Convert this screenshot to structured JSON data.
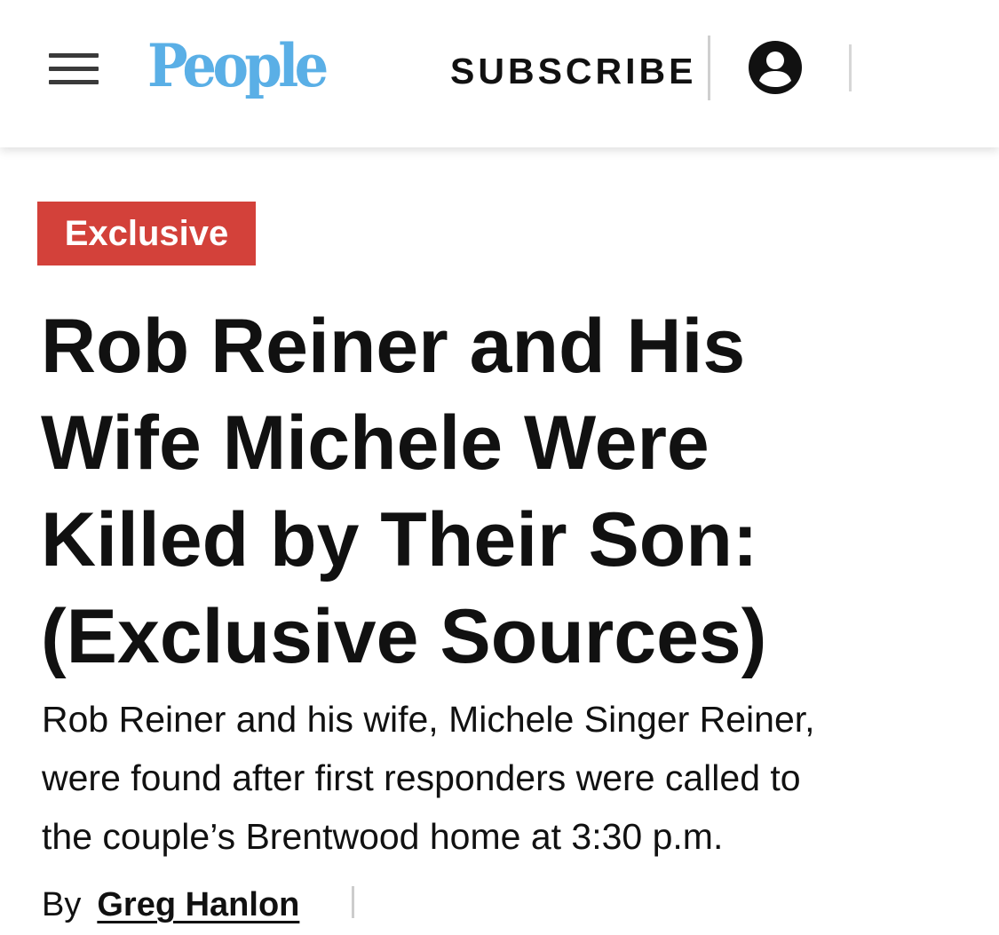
{
  "header": {
    "menu_icon": "hamburger-menu-icon",
    "logo_text": "People",
    "subscribe_label": "SUBSCRIBE",
    "account_icon": "account-user-icon",
    "logo_color": "#5aafe6"
  },
  "article": {
    "badge": "Exclusive",
    "badge_color": "#d3413a",
    "headline_lines": [
      "Rob Reiner and His",
      "Wife Michele Were",
      "Killed by Their Son:",
      "(Exclusive Sources)"
    ],
    "dek_lines": [
      "Rob Reiner and his wife, Michele Singer Reiner,",
      "were found after first responders were called to",
      "the couple’s Brentwood home at 3:30 p.m."
    ],
    "byline_prefix": "By",
    "author": "Greg Hanlon"
  }
}
